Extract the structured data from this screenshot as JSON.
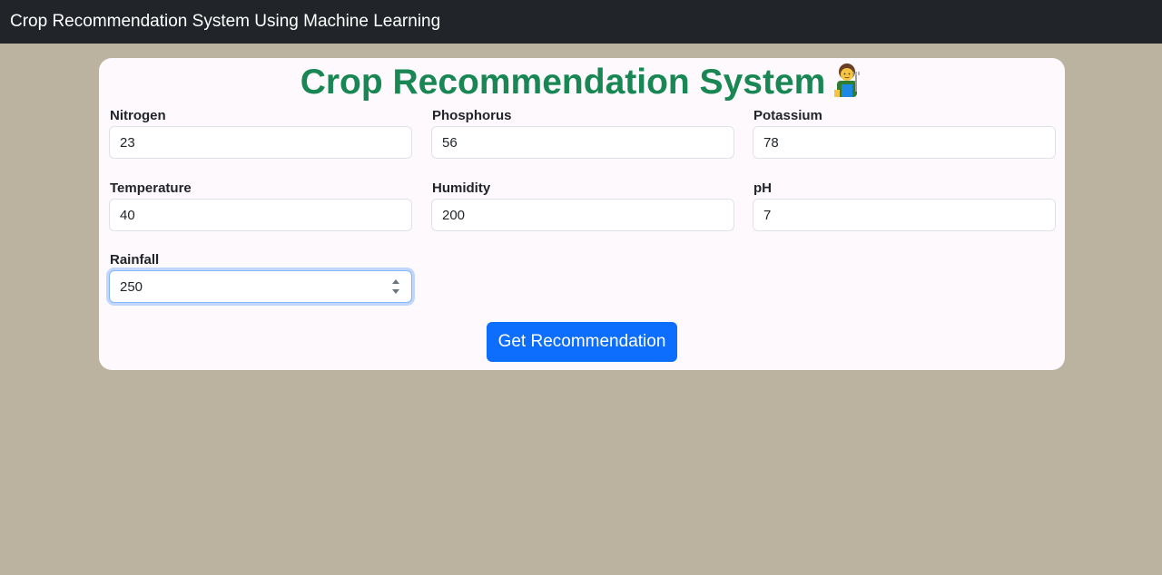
{
  "navbar": {
    "title": "Crop Recommendation System Using Machine Learning"
  },
  "card": {
    "heading": "Crop Recommendation System",
    "heading_icon": "farmer-icon",
    "heading_color": "#198754"
  },
  "form": {
    "nitrogen": {
      "label": "Nitrogen",
      "value": "23"
    },
    "phosphorus": {
      "label": "Phosphorus",
      "value": "56"
    },
    "potassium": {
      "label": "Potassium",
      "value": "78"
    },
    "temperature": {
      "label": "Temperature",
      "value": "40"
    },
    "humidity": {
      "label": "Humidity",
      "value": "200"
    },
    "ph": {
      "label": "pH",
      "value": "7"
    },
    "rainfall": {
      "label": "Rainfall",
      "value": "250"
    },
    "submit_label": "Get Recommendation"
  },
  "colors": {
    "page_background": "#bbb39f",
    "navbar_background": "#212529",
    "button_primary": "#0d6efd"
  }
}
